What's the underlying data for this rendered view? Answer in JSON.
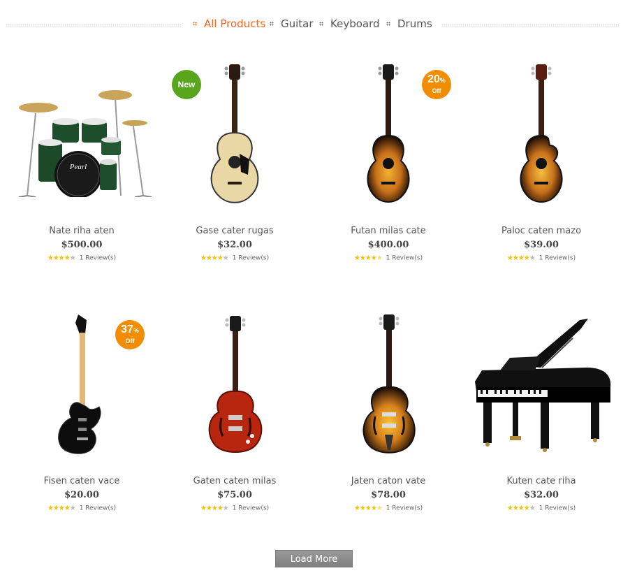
{
  "filters": {
    "all_products": "All Products",
    "guitar": "Guitar",
    "keyboard": "Keyboard",
    "drums": "Drums"
  },
  "colors": {
    "accent": "#f26522",
    "badge_new": "#5aa51e",
    "badge_sale": "#f28c00",
    "star": "#f2c200"
  },
  "products": [
    {
      "name": "Nate riha aten",
      "price": "$500.00",
      "reviews": "1 Review(s)",
      "rating": 4,
      "image": "drum-kit"
    },
    {
      "name": "Gase cater rugas",
      "price": "$32.00",
      "reviews": "1 Review(s)",
      "rating": 4,
      "image": "acoustic-guitar-natural",
      "badge": "New"
    },
    {
      "name": "Futan milas cate",
      "price": "$400.00",
      "reviews": "1 Review(s)",
      "rating": 4.5,
      "image": "acoustic-guitar-sunburst",
      "discount": "20",
      "discount_symbol": "%",
      "discount_label": "Off"
    },
    {
      "name": "Paloc caten mazo",
      "price": "$39.00",
      "reviews": "1 Review(s)",
      "rating": 4,
      "image": "acoustic-cutaway-guitar"
    },
    {
      "name": "Fisen caten vace",
      "price": "$20.00",
      "reviews": "1 Review(s)",
      "rating": 4,
      "image": "electric-guitar-black",
      "discount": "37",
      "discount_symbol": "%",
      "discount_label": "Off"
    },
    {
      "name": "Gaten caten milas",
      "price": "$75.00",
      "reviews": "1 Review(s)",
      "rating": 4,
      "image": "semi-hollow-guitar-red"
    },
    {
      "name": "Jaten caton vate",
      "price": "$78.00",
      "reviews": "1 Review(s)",
      "rating": 4.5,
      "image": "archtop-guitar-sunburst"
    },
    {
      "name": "Kuten cate riha",
      "price": "$32.00",
      "reviews": "1 Review(s)",
      "rating": 4,
      "image": "grand-piano"
    }
  ],
  "load_more": "Load More"
}
